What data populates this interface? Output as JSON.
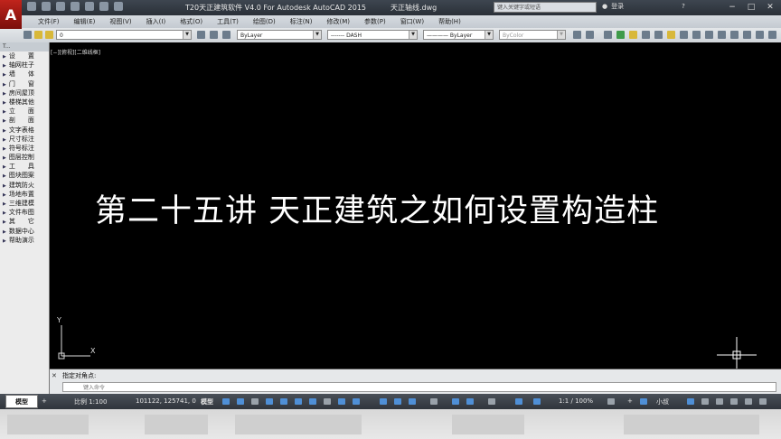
{
  "titlebar": {
    "title": "T20天正建筑软件 V4.0 For Autodesk AutoCAD 2015",
    "file": "天正轴线.dwg",
    "search_placeholder": "键入关键字或短语",
    "user_label": "登录",
    "help": "?",
    "minimize": "−",
    "maximize": "□",
    "close": "✕"
  },
  "app_logo": "A",
  "menubar": {
    "items": [
      "文件(F)",
      "编辑(E)",
      "视图(V)",
      "插入(I)",
      "格式(O)",
      "工具(T)",
      "绘图(D)",
      "标注(N)",
      "修改(M)",
      "参数(P)",
      "窗口(W)",
      "帮助(H)"
    ]
  },
  "toolbar": {
    "layer_value": "0",
    "color_value": "ByLayer",
    "linetype_value": "------- DASH",
    "lineweight_value": "———— ByLayer",
    "plotstyle_value": "ByColor"
  },
  "palette": {
    "header": "T...",
    "items": [
      "设　　置",
      "轴网柱子",
      "墙　　体",
      "门　　窗",
      "房间屋顶",
      "楼梯其他",
      "立　　面",
      "剖　　面",
      "文字表格",
      "尺寸标注",
      "符号标注",
      "图层控制",
      "工　　具",
      "图块图案",
      "建筑防火",
      "场地布置",
      "三维建模",
      "文件布图",
      "其　　它",
      "数据中心",
      "帮助演示"
    ]
  },
  "canvas": {
    "viewport_label": "[−][俯视][二维线框]",
    "caption": "第二十五讲  天正建筑之如何设置构造柱",
    "ucs_y": "Y",
    "ucs_x": "X"
  },
  "command": {
    "history": "指定对角点:",
    "placeholder": "键入命令",
    "close": "✕"
  },
  "statusbar": {
    "tab_model": "模型",
    "scale": "比例 1:100",
    "coords": "101122, 125741, 0",
    "model_btn": "模型",
    "annotation_scale": "1:1 / 100%",
    "workspace": "小叔"
  },
  "colors": {
    "canvas": "#000000",
    "caption": "#ffffff",
    "logo": "#c0241c"
  }
}
